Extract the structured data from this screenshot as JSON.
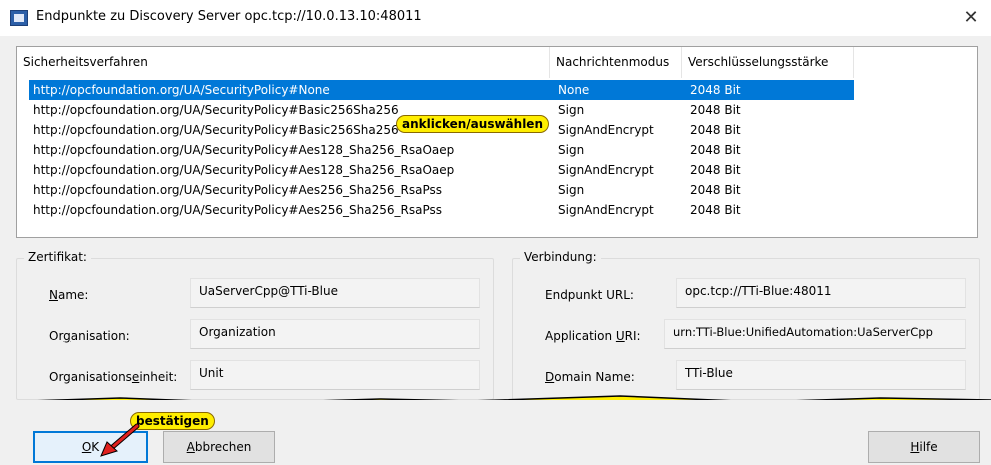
{
  "window": {
    "title": "Endpunkte zu Discovery Server opc.tcp://10.0.13.10:48011",
    "close_glyph": "✕",
    "app_icon": "app-window-icon"
  },
  "endpoints": {
    "columns": [
      "Sicherheitsverfahren",
      "Nachrichtenmodus",
      "Verschlüsselungsstärke"
    ],
    "rows": [
      {
        "policy": "http://opcfoundation.org/UA/SecurityPolicy#None",
        "mode": "None",
        "strength": "2048 Bit",
        "selected": true
      },
      {
        "policy": "http://opcfoundation.org/UA/SecurityPolicy#Basic256Sha256",
        "mode": "Sign",
        "strength": "2048 Bit"
      },
      {
        "policy": "http://opcfoundation.org/UA/SecurityPolicy#Basic256Sha256",
        "mode": "SignAndEncrypt",
        "strength": "2048 Bit"
      },
      {
        "policy": "http://opcfoundation.org/UA/SecurityPolicy#Aes128_Sha256_RsaOaep",
        "mode": "Sign",
        "strength": "2048 Bit"
      },
      {
        "policy": "http://opcfoundation.org/UA/SecurityPolicy#Aes128_Sha256_RsaOaep",
        "mode": "SignAndEncrypt",
        "strength": "2048 Bit"
      },
      {
        "policy": "http://opcfoundation.org/UA/SecurityPolicy#Aes256_Sha256_RsaPss",
        "mode": "Sign",
        "strength": "2048 Bit"
      },
      {
        "policy": "http://opcfoundation.org/UA/SecurityPolicy#Aes256_Sha256_RsaPss",
        "mode": "SignAndEncrypt",
        "strength": "2048 Bit"
      }
    ],
    "selected_color": "#0078d7"
  },
  "annotations": {
    "select_hint": "anklicken/auswählen",
    "confirm_hint": "bestätigen",
    "highlight_color": "#ffee00",
    "arrow_color": "#e0201e"
  },
  "certificate": {
    "group_label": "Zertifikat:",
    "name_label_pre": "",
    "name_label_u": "N",
    "name_label_post": "ame:",
    "name_value": "UaServerCpp@TTi-Blue",
    "org_label_pre": "Or",
    "org_label_u": "g",
    "org_label_post": "anisation:",
    "org_value": "Organization",
    "unit_label_pre": "Organisations",
    "unit_label_u": "e",
    "unit_label_post": "inheit:",
    "unit_value": "Unit"
  },
  "connection": {
    "group_label": "Verbindung:",
    "endpoint_label": "Endpunkt URL:",
    "endpoint_value": "opc.tcp://TTi-Blue:48011",
    "appuri_label_pre": "Application ",
    "appuri_label_u": "U",
    "appuri_label_post": "RI:",
    "appuri_value": "urn:TTi-Blue:UnifiedAutomation:UaServerCpp",
    "domain_label_pre": "",
    "domain_label_u": "D",
    "domain_label_post": "omain Name:",
    "domain_value": "TTi-Blue"
  },
  "buttons": {
    "ok_pre": "",
    "ok_u": "O",
    "ok_post": "K",
    "cancel_pre": "",
    "cancel_u": "A",
    "cancel_post": "bbrechen",
    "help_pre": "",
    "help_u": "H",
    "help_post": "ilfe"
  }
}
